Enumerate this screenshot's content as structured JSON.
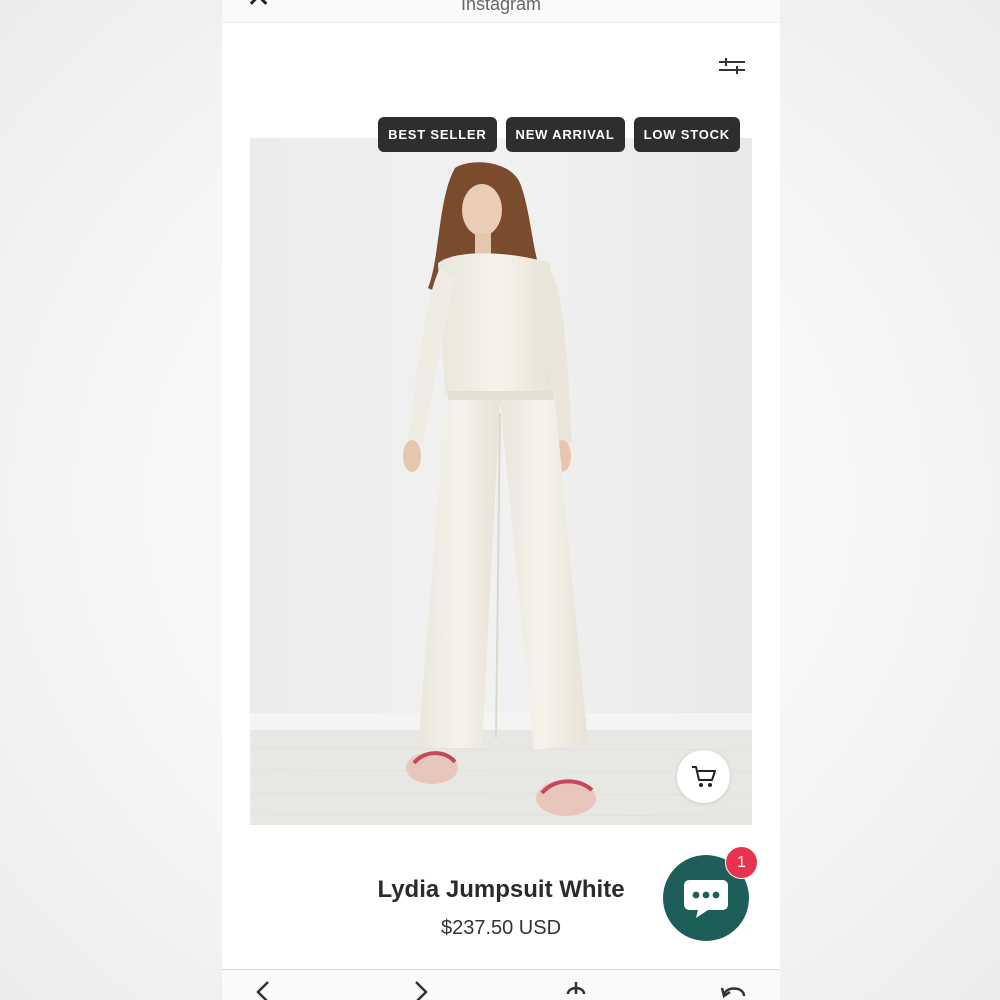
{
  "topbar": {
    "title": "Instagram",
    "close_glyph": "✕"
  },
  "icons": {
    "close": "close-icon",
    "filter": "sliders-icon",
    "cart": "cart-icon",
    "chat": "chat-bubble-icon",
    "nav_back": "chevron-left-icon",
    "nav_forward": "chevron-right-icon",
    "nav_share": "share-icon",
    "nav_reload": "reload-icon"
  },
  "badges": [
    "BEST SELLER",
    "NEW ARRIVAL",
    "LOW STOCK"
  ],
  "product": {
    "name": "Lydia Jumpsuit White",
    "price": "$237.50 USD"
  },
  "chat": {
    "count": "1"
  },
  "colors": {
    "badge_bg": "#2e2e2e",
    "chat_bg": "#1e5e58",
    "notification": "#e8334f"
  }
}
